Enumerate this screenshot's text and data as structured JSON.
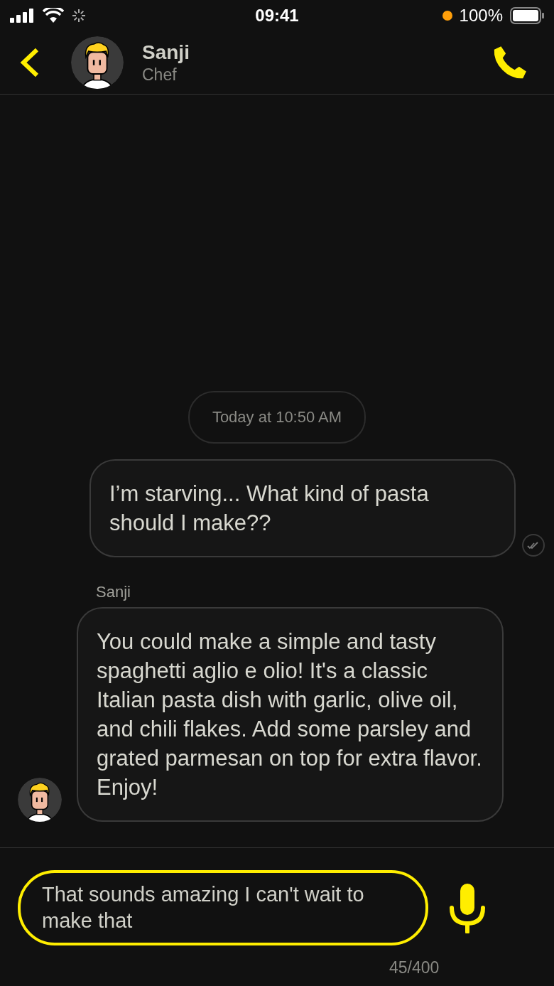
{
  "status_bar": {
    "time": "09:41",
    "battery": "100%"
  },
  "header": {
    "name": "Sanji",
    "subtitle": "Chef"
  },
  "messages": [
    {
      "kind": "timestamp",
      "text": "Today at 10:50 AM"
    },
    {
      "kind": "outgoing",
      "text": "I’m starving... What kind of pasta should I make??",
      "read": true
    },
    {
      "kind": "incoming",
      "sender": "Sanji",
      "text": "You could make a simple and tasty spaghetti aglio e olio! It's a classic Italian pasta dish with garlic, olive oil, and chili flakes. Add some parsley and grated parmesan on top for extra flavor. Enjoy!"
    }
  ],
  "composer": {
    "value": "That sounds amazing I can't wait to make that",
    "counter": "45/400"
  }
}
